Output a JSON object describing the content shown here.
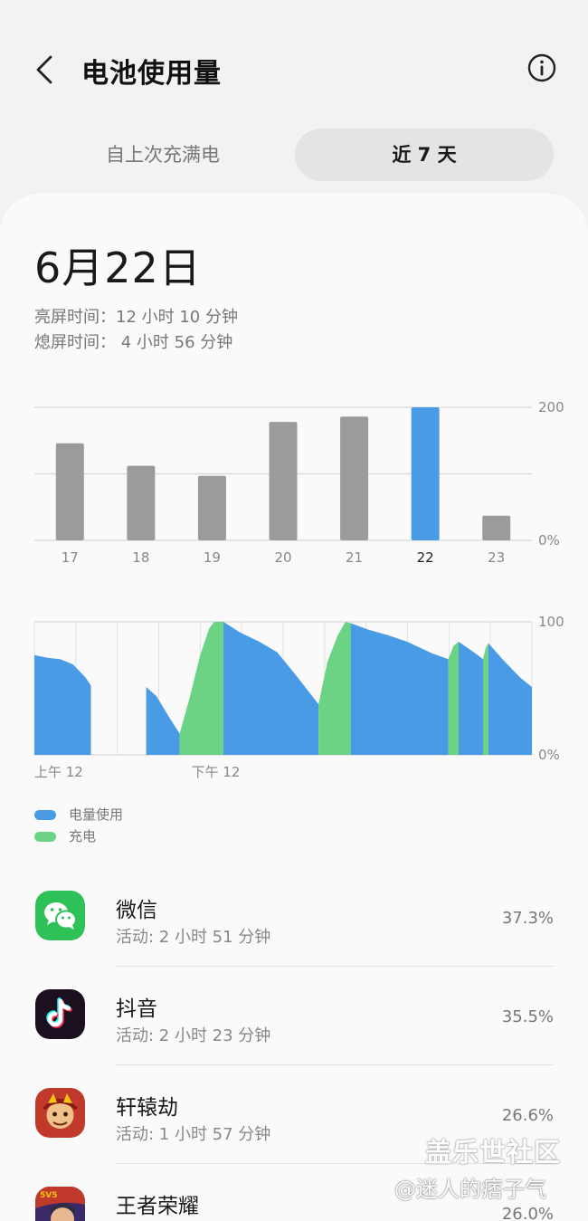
{
  "header": {
    "title": "电池使用量",
    "back_icon": "chevron-left-icon",
    "info_icon": "info-circle-icon"
  },
  "tabs": {
    "since_full_charge": "自上次充满电",
    "last_7_days": "近 7 天",
    "selected": "last_7_days"
  },
  "summary": {
    "date": "6月22日",
    "screen_on": "亮屏时间：12 小时 10 分钟",
    "screen_off": "熄屏时间： 4 小时 56 分钟"
  },
  "chart_data": [
    {
      "type": "bar",
      "categories": [
        "17",
        "18",
        "19",
        "20",
        "21",
        "22",
        "23"
      ],
      "values": [
        146,
        112,
        97,
        178,
        186,
        200,
        37
      ],
      "selected_category": "22",
      "y_tick_labels": [
        "0%",
        "200"
      ],
      "ylim": [
        0,
        200
      ],
      "colors": {
        "default": "#9b9b9b",
        "selected": "#4a9be6"
      },
      "grid": true
    },
    {
      "type": "area",
      "x_tick_labels": [
        "上午 12",
        "下午 12"
      ],
      "y_tick_labels": [
        "0%",
        "100"
      ],
      "ylim": [
        0,
        100
      ],
      "x_unit": "hours",
      "xlim": [
        0,
        24
      ],
      "series": [
        {
          "name": "电量使用",
          "color": "#4a9be6",
          "segments": [
            [
              [
                0,
                75
              ],
              [
                1,
                73
              ],
              [
                2,
                72
              ],
              [
                3,
                68
              ],
              [
                4,
                58
              ],
              [
                4.4,
                52
              ],
              [
                4.4,
                0
              ],
              [
                0,
                0
              ]
            ],
            [
              [
                8.7,
                51
              ],
              [
                9.5,
                44
              ],
              [
                10.5,
                28
              ],
              [
                11.3,
                16
              ],
              [
                11.3,
                0
              ],
              [
                8.7,
                0
              ]
            ],
            [
              [
                14.7,
                100
              ],
              [
                16,
                92
              ],
              [
                17.5,
                85
              ],
              [
                18.9,
                77
              ],
              [
                20.5,
                58
              ],
              [
                21.7,
                43
              ],
              [
                22.1,
                38
              ],
              [
                22.1,
                0
              ],
              [
                14.7,
                0
              ]
            ],
            [
              [
                24.6,
                99
              ],
              [
                26,
                94
              ],
              [
                27.5,
                90
              ],
              [
                29,
                85
              ],
              [
                31,
                76
              ],
              [
                32.2,
                72
              ],
              [
                32.2,
                0
              ],
              [
                24.6,
                0
              ]
            ],
            [
              [
                33.0,
                85
              ],
              [
                34.2,
                77
              ],
              [
                34.9,
                72
              ],
              [
                34.9,
                0
              ],
              [
                33.0,
                0
              ]
            ],
            [
              [
                35.3,
                84
              ],
              [
                36.5,
                71
              ],
              [
                37.8,
                58
              ],
              [
                38.7,
                51
              ],
              [
                38.7,
                0
              ],
              [
                35.3,
                0
              ]
            ]
          ]
        },
        {
          "name": "充电",
          "color": "#6cd384",
          "segments": [
            [
              [
                11.3,
                16
              ],
              [
                12.0,
                40
              ],
              [
                12.9,
                75
              ],
              [
                13.6,
                95
              ],
              [
                14.0,
                100
              ],
              [
                14.7,
                100
              ],
              [
                14.7,
                0
              ],
              [
                11.3,
                0
              ]
            ],
            [
              [
                22.1,
                38
              ],
              [
                22.8,
                70
              ],
              [
                23.6,
                90
              ],
              [
                24.2,
                100
              ],
              [
                24.6,
                99
              ],
              [
                24.6,
                0
              ],
              [
                22.1,
                0
              ]
            ],
            [
              [
                32.2,
                72
              ],
              [
                32.6,
                82
              ],
              [
                33.0,
                85
              ],
              [
                33.0,
                0
              ],
              [
                32.2,
                0
              ]
            ],
            [
              [
                34.9,
                72
              ],
              [
                35.1,
                80
              ],
              [
                35.3,
                84
              ],
              [
                35.3,
                0
              ],
              [
                34.9,
                0
              ]
            ]
          ]
        }
      ],
      "grid": true
    }
  ],
  "legend": [
    {
      "label": "电量使用",
      "color": "#4a9be6"
    },
    {
      "label": "充电",
      "color": "#6cd384"
    }
  ],
  "apps": [
    {
      "name": "微信",
      "activity": "活动: 2 小时 51 分钟",
      "percent": "37.3%",
      "icon": "wechat-icon"
    },
    {
      "name": "抖音",
      "activity": "活动: 2 小时 23 分钟",
      "percent": "35.5%",
      "icon": "douyin-icon"
    },
    {
      "name": "轩辕劫",
      "activity": "活动: 1 小时 57 分钟",
      "percent": "26.6%",
      "icon": "xuanyuanjie-icon"
    },
    {
      "name": "王者荣耀",
      "activity": "",
      "percent": "26.0%",
      "icon": "honor-of-kings-icon"
    }
  ],
  "watermark": {
    "line1": "盖乐世社区",
    "line2": "@迷人的痞子气"
  }
}
